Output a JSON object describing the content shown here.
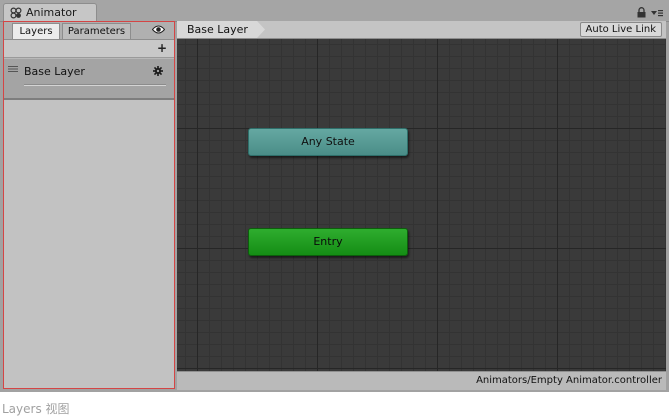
{
  "window": {
    "title": "Animator",
    "icons": {
      "tab": "animator-icon",
      "lock": "lock-icon",
      "menu": "menu-icon"
    }
  },
  "left_panel": {
    "tabs": [
      {
        "label": "Layers",
        "active": true
      },
      {
        "label": "Parameters",
        "active": false
      }
    ],
    "visibility_icon": "eye-icon",
    "add_icon": "+",
    "layers": [
      {
        "name": "Base Layer",
        "settings_icon": "gear-icon"
      }
    ]
  },
  "graph": {
    "breadcrumb": "Base Layer",
    "auto_live_link": "Auto Live Link",
    "nodes": [
      {
        "label": "Any State",
        "color": "#5a9e98"
      },
      {
        "label": "Entry",
        "color": "#1f9e1f"
      }
    ]
  },
  "status_bar": {
    "path": "Animators/Empty Animator.controller"
  },
  "caption": "Layers 视图",
  "colors": {
    "highlight_border": "#d44545",
    "graph_background": "#3a3a3a"
  }
}
